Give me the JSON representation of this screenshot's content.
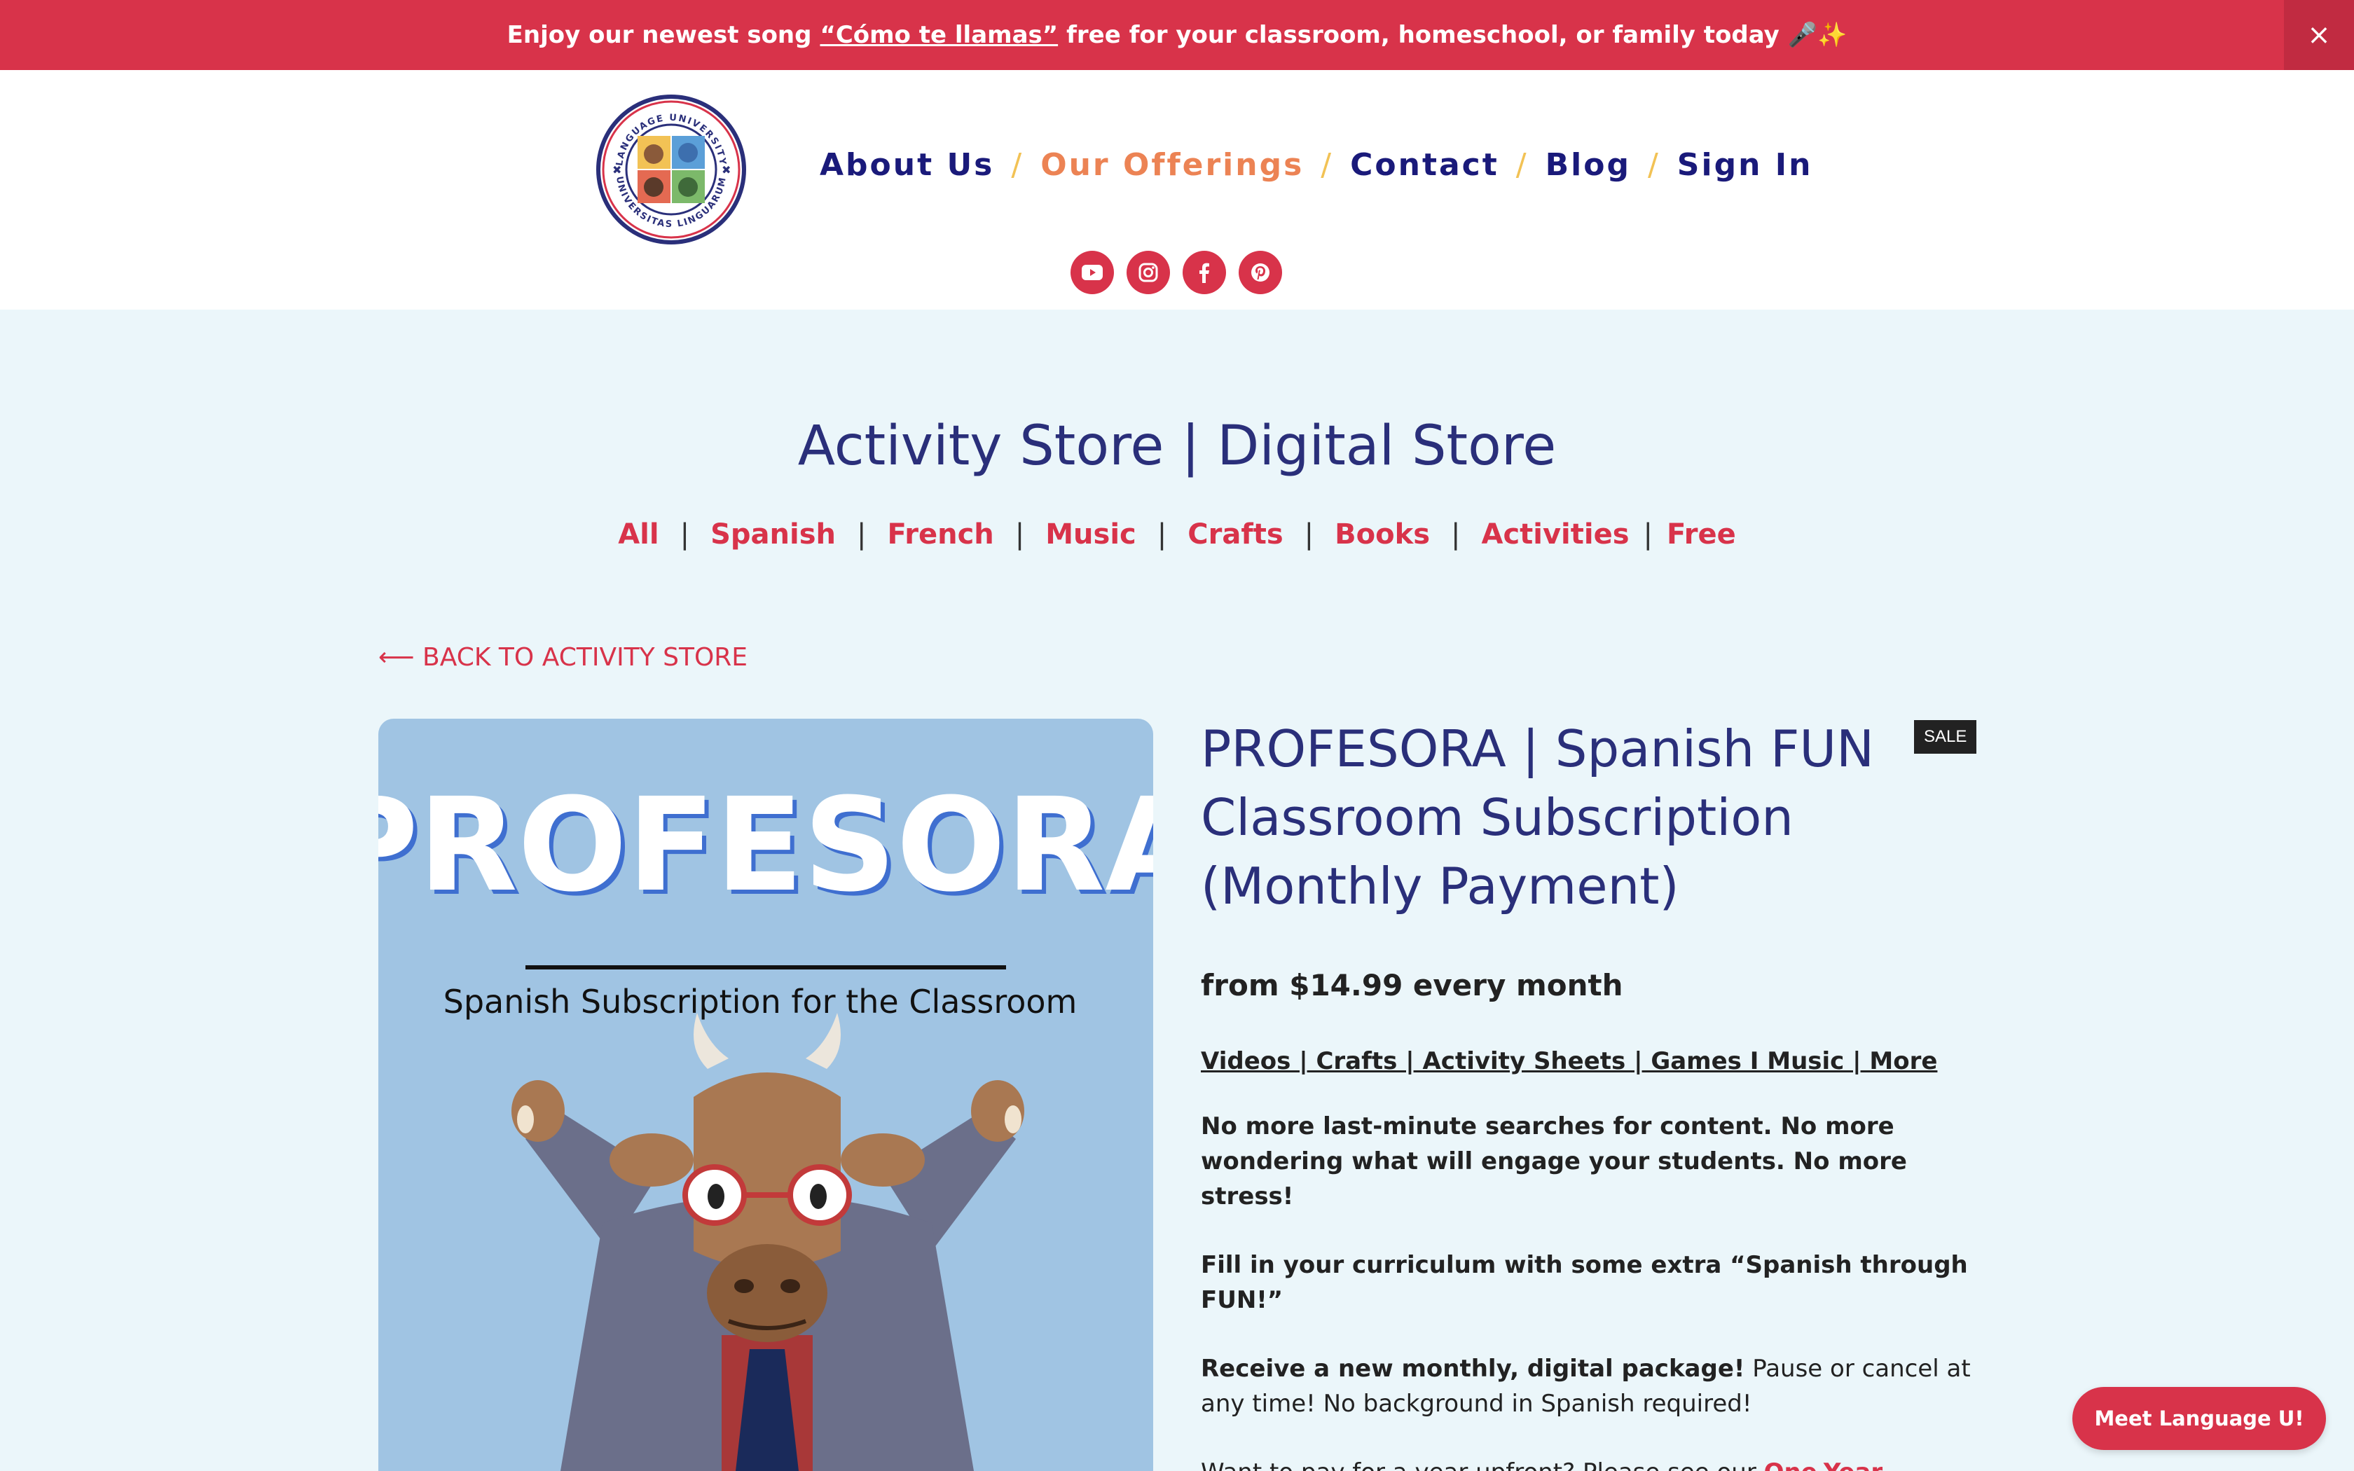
{
  "announcement": {
    "prefix": "Enjoy our newest song",
    "song_link": "“Cómo te llamas”",
    "suffix": "free for your classroom, homeschool, or family today 🎤✨",
    "close": "×"
  },
  "nav": {
    "about": "About Us",
    "offerings": "Our Offerings",
    "contact": "Contact",
    "blog": "Blog",
    "signin": "Sign In",
    "separator": "/"
  },
  "logo": {
    "top_text": "LANGUAGE UNIVERSITY",
    "bottom_text": "UNIVERSITAS LINGUARUM"
  },
  "socials": [
    "youtube-icon",
    "instagram-icon",
    "facebook-icon",
    "pinterest-icon"
  ],
  "store": {
    "title": "Activity Store | Digital Store",
    "categories": [
      "All",
      "Spanish",
      "French",
      "Music",
      "Crafts",
      "Books",
      "Activities",
      "Free"
    ],
    "separator": "|",
    "back": "⟵ BACK TO ACTIVITY STORE"
  },
  "product": {
    "image_title": "PROFESORA",
    "image_subtitle": "Spanish Subscription for the Classroom",
    "badge": "SALE",
    "title": "PROFESORA | Spanish FUN Classroom Subscription (Monthly Payment)",
    "price": "from $14.99 every month",
    "features": "Videos | Crafts | Activity Sheets | Games I Music | More",
    "para1": "No more last-minute searches for content. No more wondering what will engage your students. No more stress!",
    "para2": "Fill in your curriculum with some extra “Spanish through FUN!”",
    "para3_bold": "Receive a new monthly, digital package!",
    "para3_rest": " Pause or cancel at any time! No background in Spanish required!",
    "para4_prefix": "Want to pay for a year upfront? Please see our ",
    "para4_link": "One-Year Payment Option",
    "para4_suffix": "."
  },
  "chat_button": "Meet Language U!",
  "colors": {
    "brand_red": "#d8334a",
    "navy": "#1a1a7a",
    "orange_active": "#ec8354",
    "separator_gold": "#f2c255",
    "page_bg": "#ebf6fa",
    "image_bg": "#a0c4e3"
  }
}
